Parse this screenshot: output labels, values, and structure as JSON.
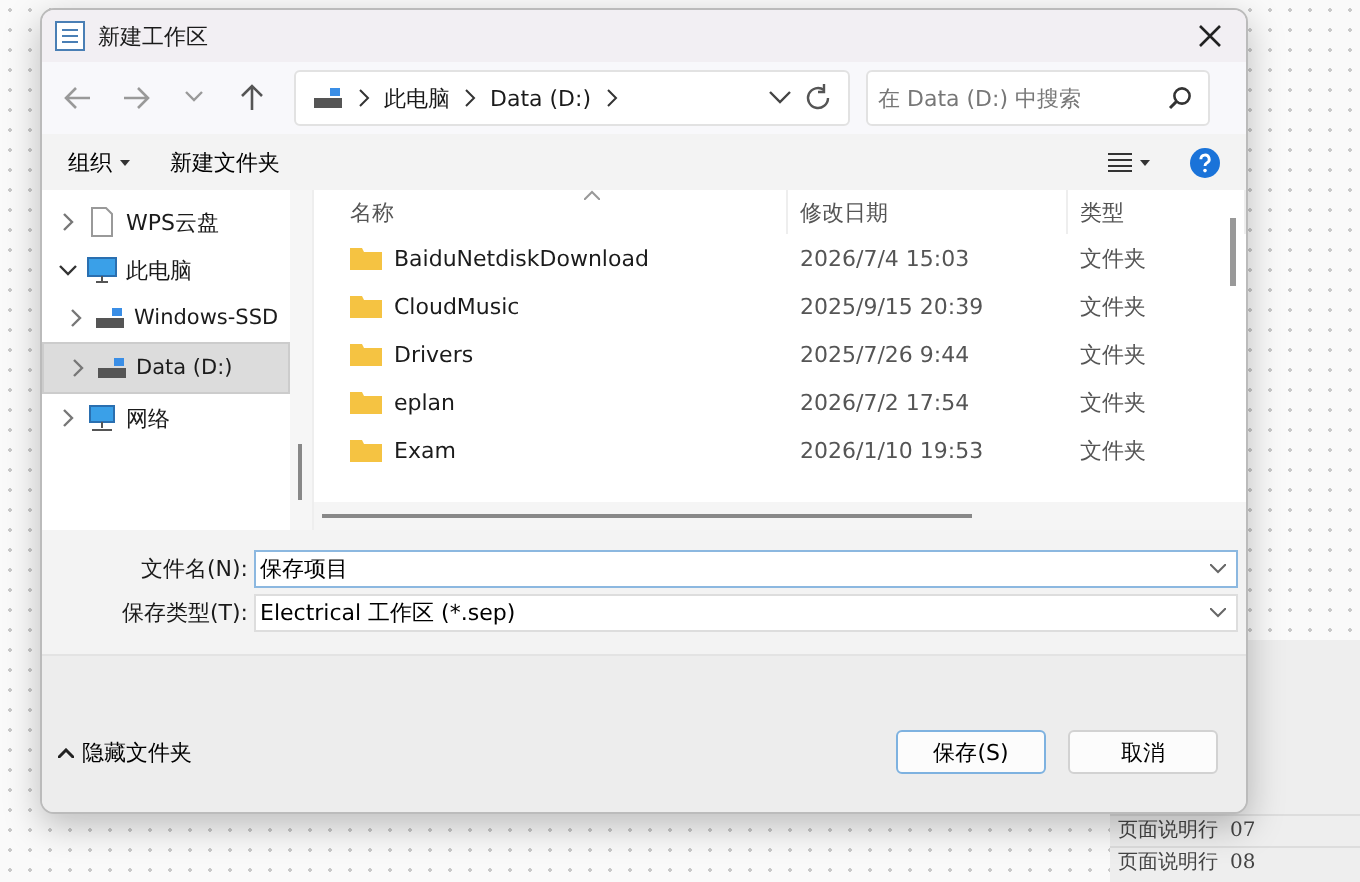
{
  "background": {
    "side_rows": [
      {
        "label": "页面说明行",
        "number": "07"
      },
      {
        "label": "页面说明行",
        "number": "08"
      }
    ]
  },
  "dialog": {
    "title": "新建工作区",
    "breadcrumb": [
      "此电脑",
      "Data (D:)"
    ],
    "search": {
      "placeholder": "在 Data (D:) 中搜索"
    },
    "toolbar": {
      "organize": "组织",
      "new_folder": "新建文件夹"
    },
    "nav": [
      {
        "label": "WPS云盘",
        "kind": "cloud",
        "expanded": false,
        "selected": false
      },
      {
        "label": "此电脑",
        "kind": "pc",
        "expanded": true,
        "selected": false,
        "children": [
          {
            "label": "Windows-SSD",
            "kind": "drive",
            "expanded": false,
            "selected": false
          },
          {
            "label": "Data (D:)",
            "kind": "drive",
            "expanded": false,
            "selected": true
          }
        ]
      },
      {
        "label": "网络",
        "kind": "network",
        "expanded": false,
        "selected": false
      }
    ],
    "columns": [
      "名称",
      "修改日期",
      "类型"
    ],
    "files": [
      {
        "name": "BaiduNetdiskDownload",
        "date": "2026/7/4 15:03",
        "type": "文件夹"
      },
      {
        "name": "CloudMusic",
        "date": "2025/9/15 20:39",
        "type": "文件夹"
      },
      {
        "name": "Drivers",
        "date": "2025/7/26 9:44",
        "type": "文件夹"
      },
      {
        "name": "eplan",
        "date": "2026/7/2 17:54",
        "type": "文件夹"
      },
      {
        "name": "Exam",
        "date": "2026/1/10 19:53",
        "type": "文件夹"
      }
    ],
    "filename": {
      "label": "文件名(N):",
      "value": "保存项目"
    },
    "filetype": {
      "label": "保存类型(T):",
      "value": "Electrical 工作区 (*.sep)"
    },
    "hide_folders": "隐藏文件夹",
    "buttons": [
      {
        "label": "保存(S)",
        "kind": "primary"
      },
      {
        "label": "取消",
        "kind": "normal"
      }
    ]
  }
}
